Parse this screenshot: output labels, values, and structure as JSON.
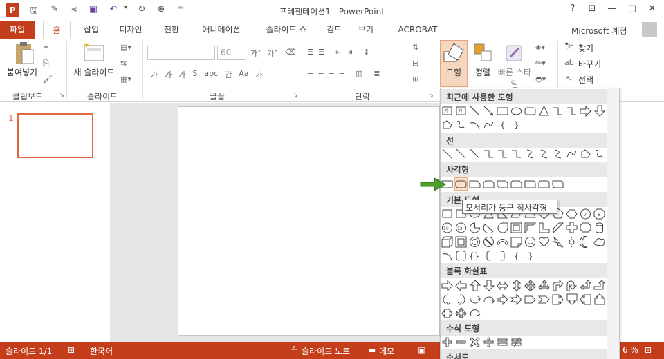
{
  "title_bar": {
    "window_title": "프레젠테이션1 - PowerPoint",
    "app_icon": "P",
    "help": "?",
    "restore": "□",
    "minimize": "—",
    "close": "✕"
  },
  "tabs": [
    "파일",
    "홈",
    "삽입",
    "디자인",
    "전환",
    "애니메이션",
    "슬라이드 쇼",
    "검토",
    "보기",
    "ACROBAT"
  ],
  "account": "Microsoft 계정",
  "ribbon": {
    "clipboard": {
      "paste": "붙여넣기",
      "label": "클립보드"
    },
    "slides": {
      "new_slide": "새 슬라이드",
      "label": "슬라이드"
    },
    "font": {
      "size": "60",
      "label": "글꼴",
      "row2": [
        "가",
        "가",
        "가",
        "S",
        "abc",
        "간",
        "Aa",
        "가"
      ]
    },
    "paragraph": {
      "label": "단락"
    },
    "drawing": {
      "shapes": "도형",
      "arrange": "정렬",
      "quick_styles": "빠른 스타일"
    },
    "editing": {
      "find": "찾기",
      "replace": "바꾸기",
      "select": "선택"
    }
  },
  "slides_pane": {
    "slide_number": "1"
  },
  "gallery": {
    "sections": [
      "최근에 사용한 도형",
      "선",
      "사각형",
      "기본 도형",
      "블록 화살표",
      "수식 도형",
      "순서도"
    ]
  },
  "tooltip": "모서리가 둥근 직사각형",
  "status": {
    "slide_count": "슬라이드 1/1",
    "language": "한국어",
    "notes": "슬라이드 노트",
    "comments": "메모",
    "zoom": "6 %"
  },
  "colors": {
    "accent": "#c43e1c",
    "highlight": "#f5d6bf",
    "thumb_border": "#e0683c",
    "arrow": "#4ca22b"
  }
}
